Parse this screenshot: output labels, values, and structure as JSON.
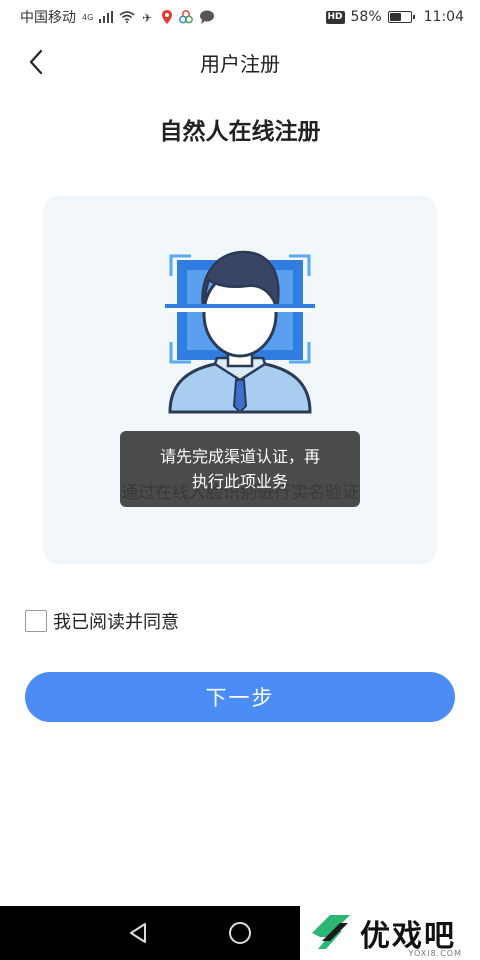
{
  "status_bar": {
    "carrier": "中国移动",
    "network": "4G",
    "battery_percent": "58%",
    "battery_level": 0.58,
    "time": "11:04",
    "hd_badge": "HD"
  },
  "header": {
    "back_icon": "chevron-left-icon",
    "title": "用户注册"
  },
  "page_title": "自然人在线注册",
  "card": {
    "illustration_icon": "face-scan-icon",
    "description": "通过在线人脸识别进行实名验证",
    "background": "#f1f7fb"
  },
  "toast": {
    "line1": "请先完成渠道认证，再",
    "line2": "执行此项业务"
  },
  "agreement": {
    "checked": false,
    "label": "我已阅读并同意"
  },
  "next_button": {
    "label": "下一步",
    "color": "#4b8cf5"
  },
  "nav_bar": {
    "back_icon": "triangle-back-icon",
    "home_icon": "circle-home-icon"
  },
  "watermark": {
    "text": "优戏吧",
    "sub": "YOXI8.COM"
  }
}
